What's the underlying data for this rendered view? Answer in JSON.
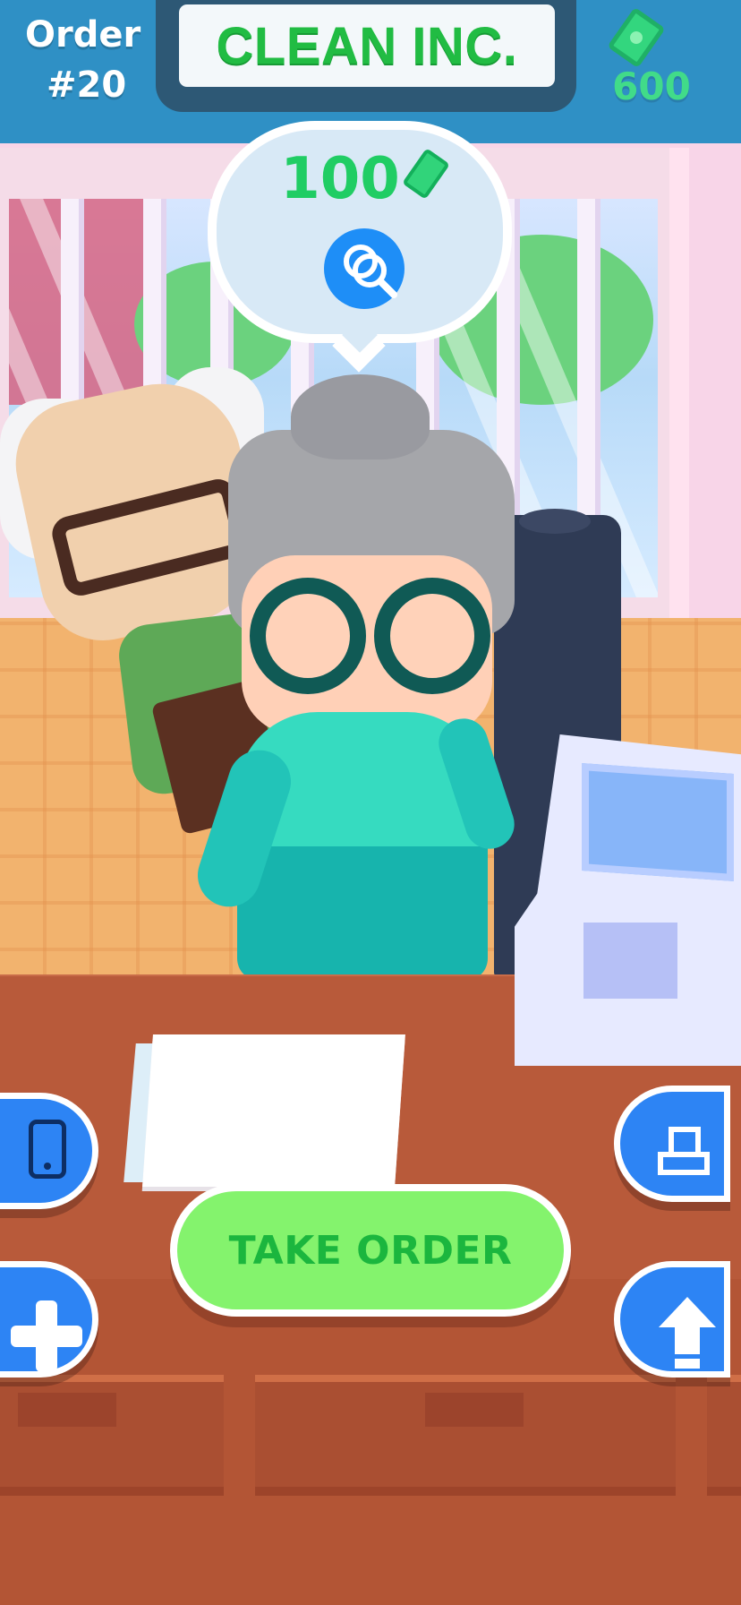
{
  "header": {
    "order_label": "Order",
    "order_number": "#20",
    "company_name": "CLEAN INC.",
    "money_value": "600",
    "money_icon": "cash-icon"
  },
  "customer_request": {
    "price": "100",
    "currency_icon": "cash-icon",
    "service_icon": "laundry-service-icon"
  },
  "controls": {
    "phone_button_icon": "phone-icon",
    "add_button_icon": "plus-icon",
    "cleaning_button_icon": "cleaning-machine-icon",
    "upgrade_button_icon": "upgrade-arrow-icon",
    "take_order_label": "TAKE ORDER"
  },
  "colors": {
    "brand_green": "#21bc43",
    "button_blue": "#2d84f4",
    "money_green": "#41db89",
    "take_order_green": "#84f36d"
  }
}
